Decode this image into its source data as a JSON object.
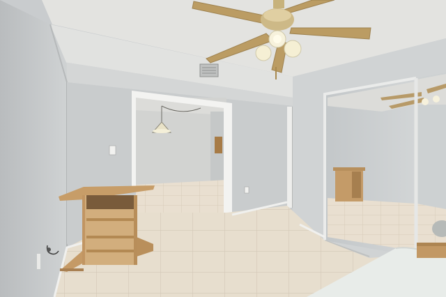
{
  "scene": {
    "kind": "photograph",
    "colors": {
      "wall": "#c8cbcc",
      "ceiling": "#e4e4e1",
      "floor_tile": "#e6dccd",
      "wood": "#c8a374",
      "fan_blade": "#b99a63"
    }
  }
}
